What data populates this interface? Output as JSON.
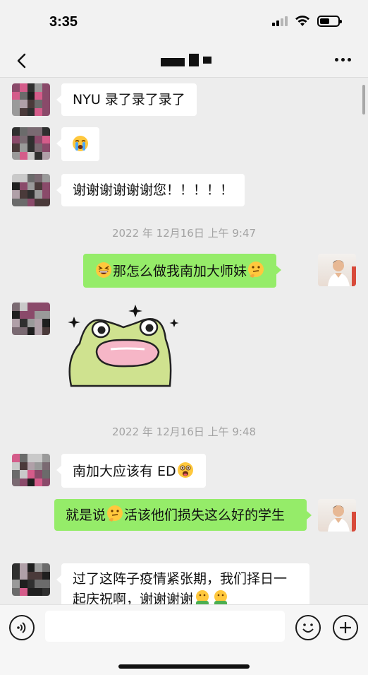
{
  "status_bar": {
    "time": "3:35"
  },
  "nav": {
    "contact_name": "",
    "back_icon": "chevron-left-icon",
    "more_icon": "more-dots-icon"
  },
  "messages": [
    {
      "side": "in",
      "text": "NYU 录了录了录了"
    },
    {
      "side": "in",
      "emoji": "loudly-crying-face"
    },
    {
      "side": "in",
      "text": "谢谢谢谢谢谢您！！！！！"
    },
    {
      "type": "timestamp",
      "text": "2022 年 12月16日 上午 9:47"
    },
    {
      "side": "out",
      "text": "那怎么做我南加大师妹",
      "lead_emoji": "grinning-squinting-face",
      "trail_emoji": "thinking-face"
    },
    {
      "side": "in",
      "sticker": "happy-frog-sticker"
    },
    {
      "type": "timestamp",
      "text": "2022 年 12月16日 上午 9:48"
    },
    {
      "side": "in",
      "text": "南加大应该有 ED",
      "trail_emoji": "astonished-face"
    },
    {
      "side": "out",
      "text_a": "就是说",
      "text_b": "活该他们损失这么好的学生",
      "mid_emoji": "thinking-face"
    },
    {
      "side": "in",
      "text": "过了这阵子疫情紧张期，我们择日一起庆祝啊，谢谢谢谢",
      "trail_emoji": "hugging-face"
    }
  ],
  "input_bar": {
    "voice_icon": "voice-icon",
    "emoji_icon": "smile-icon",
    "plus_icon": "plus-icon"
  },
  "colors": {
    "out_bubble": "#95ec69",
    "in_bubble": "#ffffff",
    "background": "#ededed"
  }
}
